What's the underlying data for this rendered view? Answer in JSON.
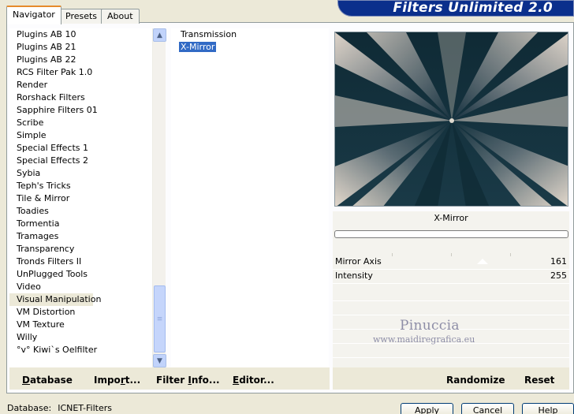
{
  "banner": {
    "title": "Filters Unlimited 2.0"
  },
  "tabs": [
    {
      "label": "Navigator",
      "active": true
    },
    {
      "label": "Presets",
      "active": false
    },
    {
      "label": "About",
      "active": false
    }
  ],
  "categories": [
    "Plugins AB 10",
    "Plugins AB 21",
    "Plugins AB 22",
    "RCS Filter Pak 1.0",
    "Render",
    "Rorshack Filters",
    "Sapphire Filters 01",
    "Scribe",
    "Simple",
    "Special Effects 1",
    "Special Effects 2",
    "Sybia",
    "Teph's Tricks",
    "Tile & Mirror",
    "Toadies",
    "Tormentia",
    "Tramages",
    "Transparency",
    "Tronds Filters II",
    "UnPlugged Tools",
    "Video",
    "Visual Manipulation",
    "VM Distortion",
    "VM Texture",
    "Willy",
    "°v° Kiwi`s Oelfilter"
  ],
  "selected_category": "Visual Manipulation",
  "filters": [
    "Transmission",
    "X-Mirror"
  ],
  "selected_filter": "X-Mirror",
  "preview": {
    "filter_name": "X-Mirror"
  },
  "params": [
    {
      "label": "Mirror Axis",
      "value": "161"
    },
    {
      "label": "Intensity",
      "value": "255"
    }
  ],
  "watermark": {
    "line1": "Pinuccia",
    "line2": "www.maidiregrafica.eu"
  },
  "left_buttons": {
    "database": {
      "u": "D",
      "rest": "atabase"
    },
    "import": {
      "pre": "Impo",
      "u": "r",
      "rest": "t..."
    },
    "filter_info": {
      "pre": "Filter ",
      "u": "I",
      "rest": "nfo..."
    },
    "editor": {
      "u": "E",
      "rest": "ditor..."
    }
  },
  "right_buttons": {
    "randomize": "Randomize",
    "reset": "Reset"
  },
  "status": {
    "label": "Database:",
    "value": "ICNET-Filters"
  },
  "dialog_buttons": {
    "apply": "Apply",
    "cancel": "Cancel",
    "help": "Help"
  },
  "colors": {
    "accent": "#316ac5",
    "banner": "#0b2f8c",
    "tab_highlight": "#e68b2c"
  }
}
